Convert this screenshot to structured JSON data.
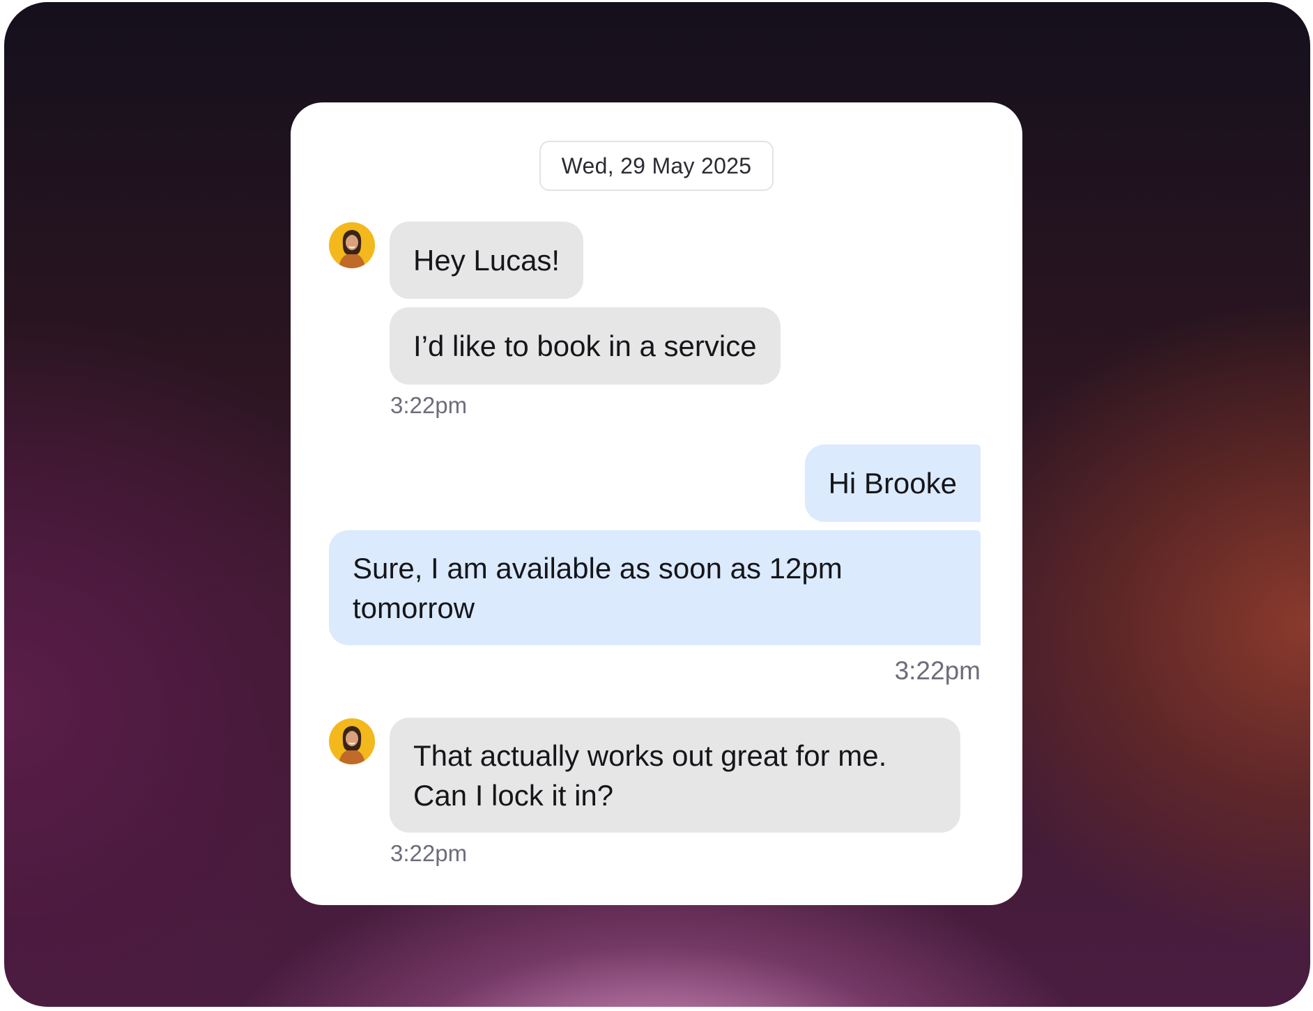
{
  "conversation": {
    "date": "Wed, 29 May 2025",
    "contact_avatar_icon": "person-avatar-icon",
    "messages": [
      {
        "direction": "incoming",
        "text": "Hey Lucas!"
      },
      {
        "direction": "incoming",
        "text": "I’d like to book in a service",
        "time": "3:22pm"
      },
      {
        "direction": "outgoing",
        "text": "Hi Brooke"
      },
      {
        "direction": "outgoing",
        "text": "Sure, I am available as soon as 12pm tomorrow",
        "time": "3:22pm"
      },
      {
        "direction": "incoming",
        "text": "That actually works out great for me. Can I lock it in?",
        "time": "3:22pm"
      }
    ]
  },
  "colors": {
    "incoming_bubble": "#e6e6e6",
    "outgoing_bubble": "#dbeafc",
    "avatar_background": "#f3b81c",
    "timestamp": "#6d6d7a"
  }
}
